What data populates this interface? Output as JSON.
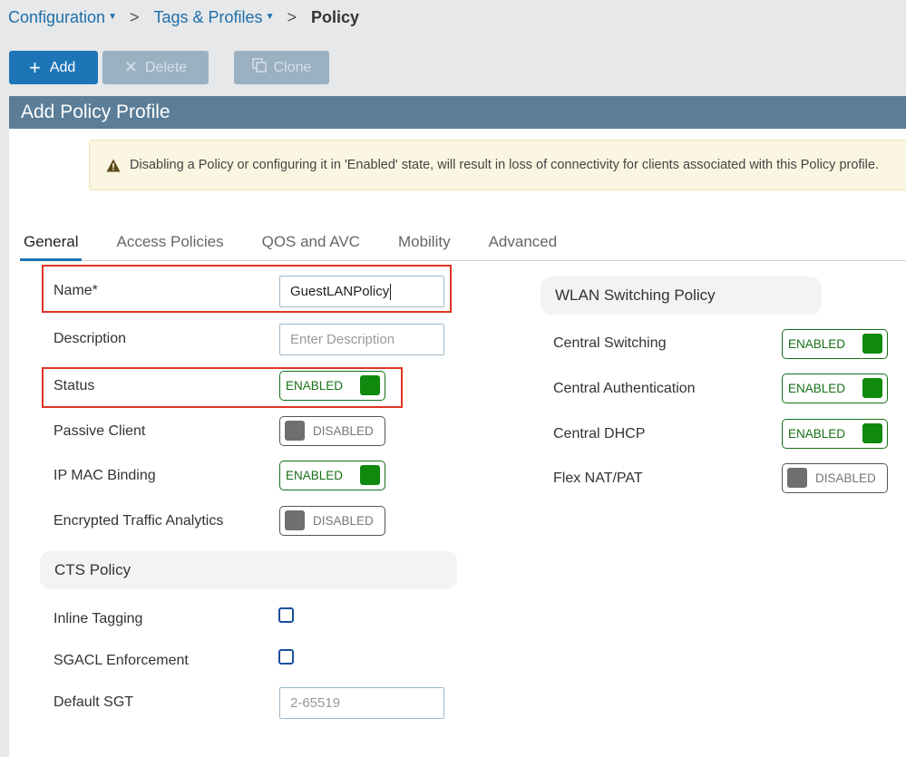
{
  "breadcrumb": {
    "items": [
      "Configuration",
      "Tags & Profiles"
    ],
    "separator": ">",
    "current": "Policy"
  },
  "toolbar": {
    "add_label": "Add",
    "delete_label": "Delete",
    "clone_label": "Clone"
  },
  "panel": {
    "title": "Add Policy Profile",
    "warning": "Disabling a Policy or configuring it in 'Enabled' state, will result in loss of connectivity for clients associated with this Policy profile."
  },
  "tabs": [
    {
      "label": "General",
      "active": true
    },
    {
      "label": "Access Policies",
      "active": false
    },
    {
      "label": "QOS and AVC",
      "active": false
    },
    {
      "label": "Mobility",
      "active": false
    },
    {
      "label": "Advanced",
      "active": false
    }
  ],
  "general": {
    "name_label": "Name*",
    "name_value": "GuestLANPolicy",
    "description_label": "Description",
    "description_placeholder": "Enter Description",
    "status_label": "Status",
    "status_value": "ENABLED",
    "passive_client_label": "Passive Client",
    "passive_client_value": "DISABLED",
    "ip_mac_binding_label": "IP MAC Binding",
    "ip_mac_binding_value": "ENABLED",
    "eta_label": "Encrypted Traffic Analytics",
    "eta_value": "DISABLED"
  },
  "cts_policy": {
    "title": "CTS Policy",
    "inline_tagging_label": "Inline Tagging",
    "inline_tagging_checked": false,
    "sgacl_label": "SGACL Enforcement",
    "sgacl_checked": false,
    "default_sgt_label": "Default SGT",
    "default_sgt_placeholder": "2-65519"
  },
  "wlan_switching": {
    "title": "WLAN Switching Policy",
    "central_switching_label": "Central Switching",
    "central_switching_value": "ENABLED",
    "central_auth_label": "Central Authentication",
    "central_auth_value": "ENABLED",
    "central_dhcp_label": "Central DHCP",
    "central_dhcp_value": "ENABLED",
    "flex_nat_label": "Flex NAT/PAT",
    "flex_nat_value": "DISABLED"
  },
  "colors": {
    "accent": "#1d75b8",
    "header": "#5b7d97",
    "enabled": "#0f8a0f",
    "highlight": "#e03423"
  }
}
